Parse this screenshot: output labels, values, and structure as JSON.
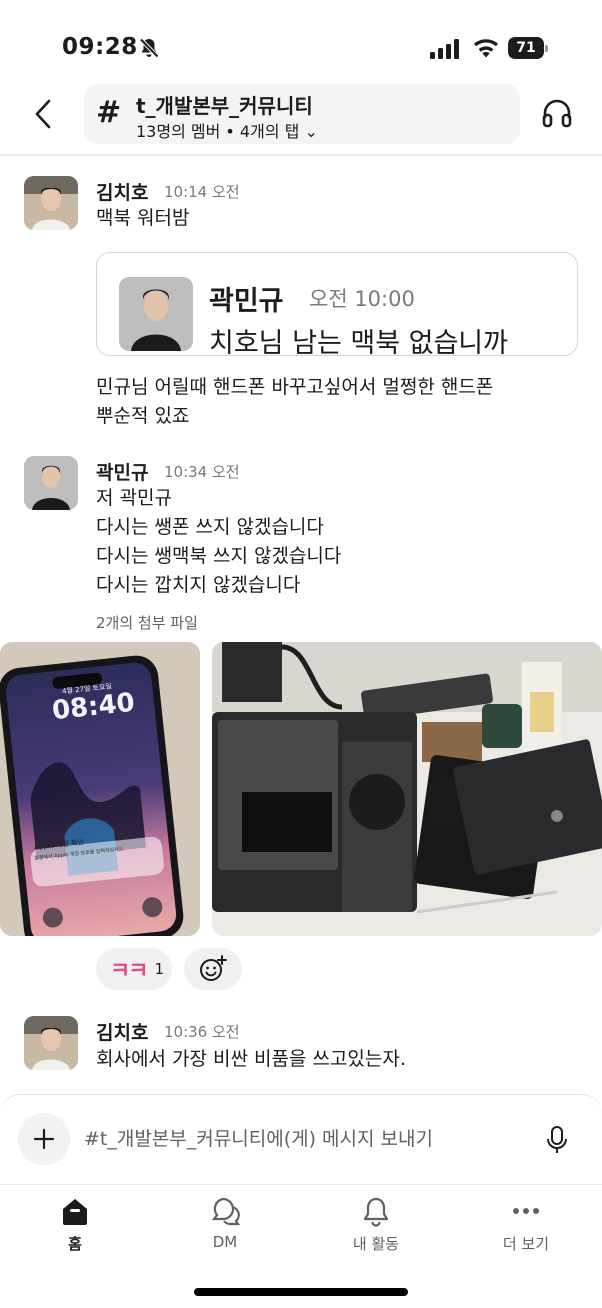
{
  "status_bar": {
    "time": "09:28",
    "battery": "71"
  },
  "header": {
    "channel_name": "t_개발본부_커뮤니티",
    "meta": "13명의 멤버 • 4개의 탭",
    "meta_chevron": "⌄"
  },
  "messages": [
    {
      "sender": "김치호",
      "time": "10:14 오전",
      "text": "맥북 워터밤",
      "quote": {
        "sender": "곽민규",
        "time": "오전 10:00",
        "text": "치호님 남는 맥북 없습니까"
      },
      "reply_lines": [
        "민규님 어릴때 핸드폰 바꾸고싶어서 멀쩡한 핸드폰",
        "뿌순적 있죠"
      ]
    },
    {
      "sender": "곽민규",
      "time": "10:34 오전",
      "lines": [
        "저 곽민규",
        "다시는 쌩폰 쓰지 않겠습니다",
        "다시는 쌩맥북 쓰지 않겠습니다",
        "다시는 깝치지 않겠습니다"
      ],
      "attachments_label": "2개의 첨부 파일",
      "phone_screen": {
        "date": "4월 27일 토요일",
        "clock": "08:40",
        "notice_title": "Apple 계정 확인",
        "notice_body": "설정에서 Apple 계정 암호를 입력하십시오."
      },
      "reactions": [
        {
          "emoji": "ㅋㅋ",
          "count": "1"
        }
      ]
    },
    {
      "sender": "김치호",
      "time": "10:36 오전",
      "text": "회사에서 가장 비싼 비품을 쓰고있는자."
    }
  ],
  "composer": {
    "placeholder": "#t_개발본부_커뮤니티에(게) 메시지 보내기"
  },
  "tabs": [
    {
      "label": "홈",
      "icon": "home-icon",
      "active": true
    },
    {
      "label": "DM",
      "icon": "dm-icon",
      "active": false
    },
    {
      "label": "내 활동",
      "icon": "bell-icon",
      "active": false
    },
    {
      "label": "더 보기",
      "icon": "more-icon",
      "active": false
    }
  ],
  "colors": {
    "reaction": "#e64a8a",
    "text": "#1d1c1d",
    "muted": "#7a7a7a"
  }
}
